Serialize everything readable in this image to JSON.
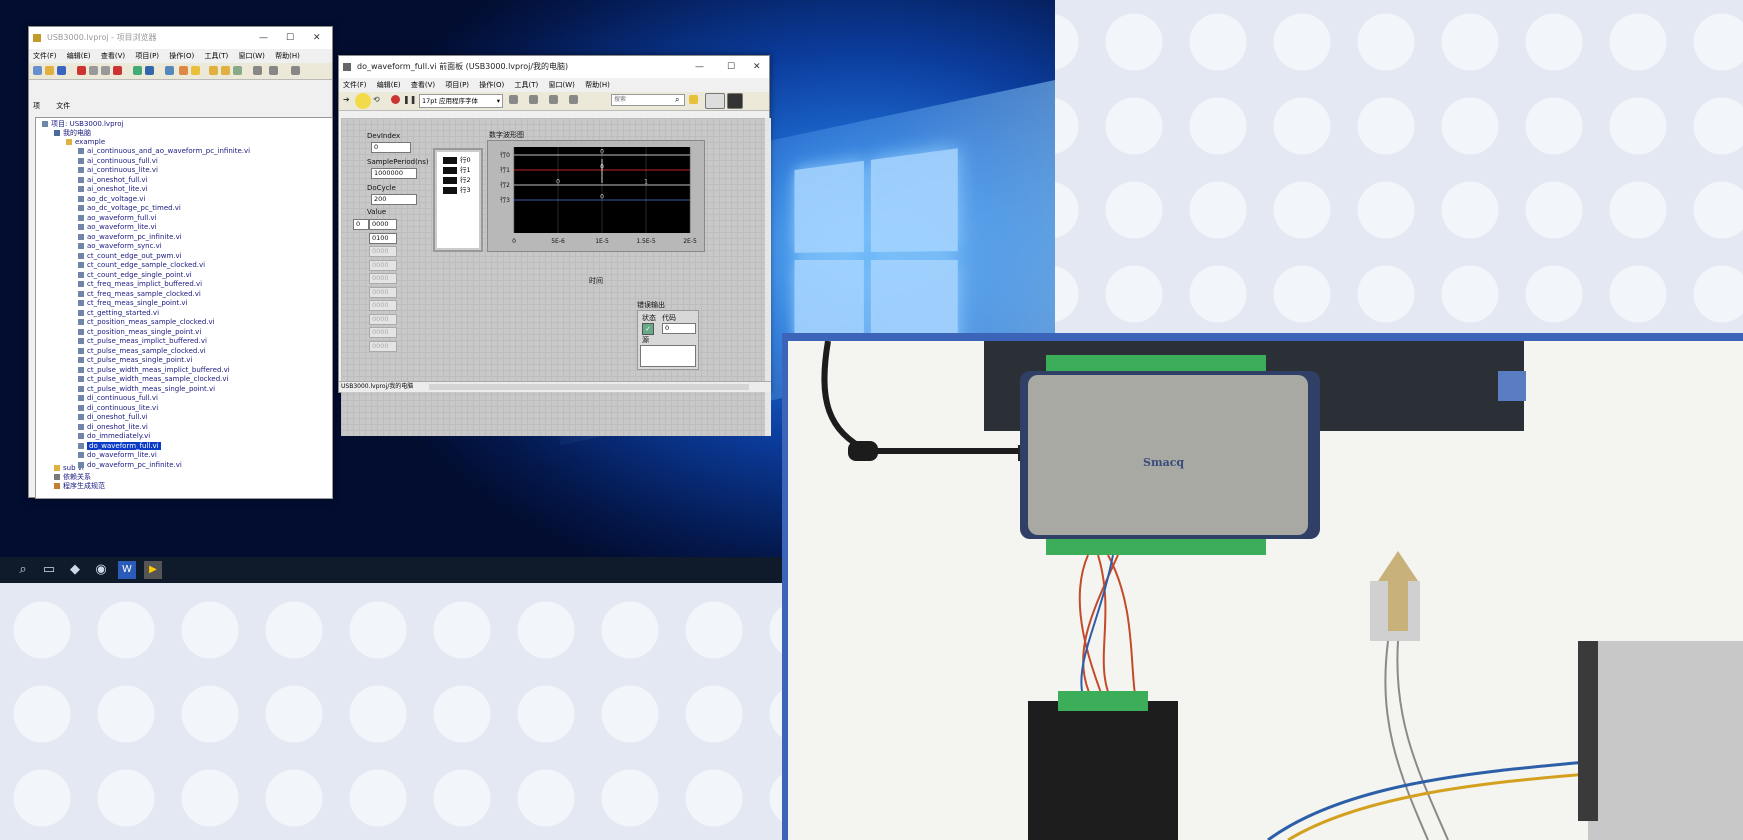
{
  "project_window": {
    "title": "USB3000.lvproj - 项目浏览器",
    "menu": [
      "文件(F)",
      "编辑(E)",
      "查看(V)",
      "项目(P)",
      "操作(O)",
      "工具(T)",
      "窗口(W)",
      "帮助(H)"
    ],
    "tabs": [
      "项",
      "文件"
    ],
    "tree": {
      "root": "项目: USB3000.lvproj",
      "computer": "我的电脑",
      "folder": "example",
      "items": [
        "ai_continuous_and_ao_waveform_pc_infinite.vi",
        "ai_continuous_full.vi",
        "ai_continuous_lite.vi",
        "ai_oneshot_full.vi",
        "ai_oneshot_lite.vi",
        "ao_dc_voltage.vi",
        "ao_dc_voltage_pc_timed.vi",
        "ao_waveform_full.vi",
        "ao_waveform_lite.vi",
        "ao_waveform_pc_infinite.vi",
        "ao_waveform_sync.vi",
        "ct_count_edge_out_pwm.vi",
        "ct_count_edge_sample_clocked.vi",
        "ct_count_edge_single_point.vi",
        "ct_freq_meas_implict_buffered.vi",
        "ct_freq_meas_sample_clocked.vi",
        "ct_freq_meas_single_point.vi",
        "ct_getting_started.vi",
        "ct_position_meas_sample_clocked.vi",
        "ct_position_meas_single_point.vi",
        "ct_pulse_meas_implict_buffered.vi",
        "ct_pulse_meas_sample_clocked.vi",
        "ct_pulse_meas_single_point.vi",
        "ct_pulse_width_meas_implict_buffered.vi",
        "ct_pulse_width_meas_sample_clocked.vi",
        "ct_pulse_width_meas_single_point.vi",
        "di_continuous_full.vi",
        "di_continuous_lite.vi",
        "di_oneshot_full.vi",
        "di_oneshot_lite.vi",
        "do_immediately.vi",
        "do_waveform_full.vi",
        "do_waveform_lite.vi",
        "do_waveform_pc_infinite.vi"
      ],
      "selected_index": 31,
      "after": [
        "sub vi",
        "依赖关系",
        "程序生成规范"
      ]
    }
  },
  "vi_window": {
    "title": "do_waveform_full.vi 前面板 (USB3000.lvproj/我的电脑)",
    "menu": [
      "文件(F)",
      "编辑(E)",
      "查看(V)",
      "项目(P)",
      "操作(O)",
      "工具(T)",
      "窗口(W)",
      "帮助(H)"
    ],
    "font_select": "17pt 应用程序字体",
    "search_placeholder": "搜索",
    "status_path": "USB3000.lvproj/我的电脑",
    "controls": {
      "devindex_label": "DevIndex",
      "devindex_value": "0",
      "sampleperiod_label": "SamplePeriod(ns)",
      "sampleperiod_value": "1000000",
      "docycle_label": "DoCycle",
      "docycle_value": "200",
      "value_label": "Value",
      "value_index": "0",
      "value_items": [
        "0000",
        "0100",
        "0000",
        "0000",
        "0000",
        "0000",
        "0000",
        "0000",
        "0000",
        "0000"
      ]
    },
    "legend": [
      "行0",
      "行1",
      "行2",
      "行3"
    ],
    "graph": {
      "title": "数字波形图",
      "xlabel": "时间",
      "xticks": [
        "0",
        "5E-6",
        "1E-5",
        "1.5E-5",
        "2E-5"
      ],
      "rows": [
        "行0",
        "行1",
        "行2",
        "行3"
      ],
      "row_values": [
        [
          "0"
        ],
        [
          "0"
        ],
        [
          "0",
          "1"
        ],
        [
          "0"
        ]
      ]
    },
    "error_out": {
      "label": "错误输出",
      "status_label": "状态",
      "code_label": "代码",
      "code_value": "0",
      "source_label": "源"
    }
  },
  "device": {
    "brand": "Smacq"
  },
  "colors": {
    "accent_orange": "#f07850",
    "photo_frame": "#3c64b8",
    "selection": "#0a3cc8",
    "trace_red": "#ff3030"
  }
}
